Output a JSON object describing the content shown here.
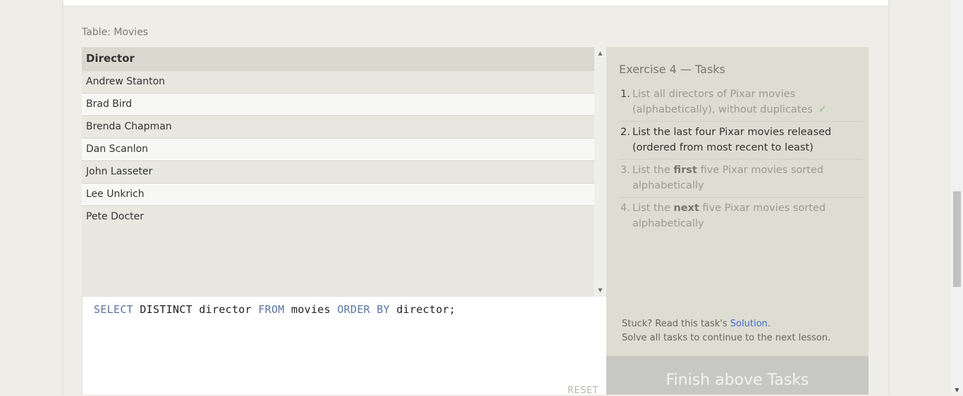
{
  "table": {
    "caption": "Table: Movies",
    "header": "Director",
    "rows": [
      "Andrew Stanton",
      "Brad Bird",
      "Brenda Chapman",
      "Dan Scanlon",
      "John Lasseter",
      "Lee Unkrich",
      "Pete Docter"
    ]
  },
  "editor": {
    "kw_select": "SELECT",
    "t_distinct": "DISTINCT director",
    "kw_from": "FROM",
    "t_movies": "movies",
    "kw_orderby": "ORDER BY",
    "t_director": "director;",
    "reset_label": "RESET"
  },
  "tasks": {
    "title": "Exercise 4 — Tasks",
    "items": [
      {
        "num": "1.",
        "text": "List all directors of Pixar movies (alphabetically), without duplicates",
        "check": "✓"
      },
      {
        "num": "2.",
        "text": "List the last four Pixar movies released (ordered from most recent to least)"
      },
      {
        "num": "3.",
        "pre": "List the ",
        "bold": "first",
        "post": " five Pixar movies sorted alphabetically"
      },
      {
        "num": "4.",
        "pre": "List the ",
        "bold": "next",
        "post": " five Pixar movies sorted alphabetically"
      }
    ],
    "stuck_pre": "Stuck? Read this task's ",
    "solution_link": "Solution",
    "stuck_post": ".",
    "solve_all": "Solve all tasks to continue to the next lesson.",
    "finish_button": "Finish above Tasks"
  },
  "icons": {
    "scroll_up": "scroll-up-icon",
    "scroll_down": "scroll-down-icon",
    "check": "check-icon"
  },
  "colors": {
    "keyword": "#5b74a0",
    "link": "#3a6bc9",
    "check": "#8cbf8c",
    "finish_button_bg": "#c7c7c3"
  }
}
